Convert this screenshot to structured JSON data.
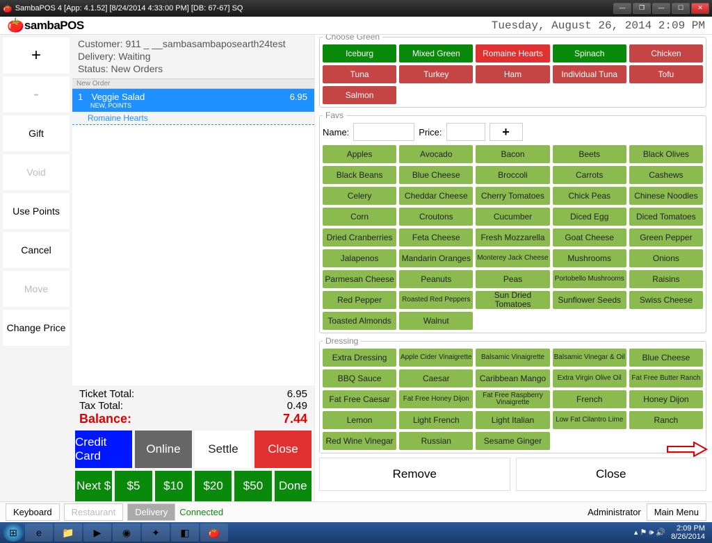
{
  "window": {
    "title": "SambaPOS 4 [App: 4.1.52] [8/24/2014 4:33:00 PM] [DB: 67-67] SQ"
  },
  "header": {
    "logo_a": "samba",
    "logo_b": "POS",
    "datetime": "Tuesday, August 26, 2014 2:09 PM"
  },
  "actions": {
    "add": "+",
    "minus": "-",
    "gift": "Gift",
    "void": "Void",
    "usepoints": "Use Points",
    "cancel": "Cancel",
    "move": "Move",
    "changeprice": "Change Price"
  },
  "customer": {
    "line1": "Customer: 911 _ __sambasambaposearth24test",
    "line2": "Delivery: Waiting",
    "line3": "Status: New Orders"
  },
  "order": {
    "header": "New Order",
    "qty": "1",
    "name": "Veggie Salad",
    "price": "6.95",
    "tags": "NEW, POINTS",
    "modifier": "Romaine Hearts"
  },
  "totals": {
    "ticket_label": "Ticket Total:",
    "ticket_val": "6.95",
    "tax_label": "Tax Total:",
    "tax_val": "0.49",
    "balance_label": "Balance:",
    "balance_val": "7.44"
  },
  "pay": {
    "cc": "Credit Card",
    "online": "Online",
    "settle": "Settle",
    "close": "Close"
  },
  "cash": {
    "next": "Next $",
    "b5": "$5",
    "b10": "$10",
    "b20": "$20",
    "b50": "$50",
    "done": "Done"
  },
  "groups": {
    "choose_green": "Choose Green",
    "greens": [
      "Iceburg",
      "Mixed Green",
      "Romaine Hearts",
      "Spinach",
      "Chicken",
      "Tuna",
      "Turkey",
      "Ham",
      "Individual Tuna",
      "Tofu",
      "Salmon"
    ],
    "greens_color": [
      "green",
      "green",
      "sel",
      "green",
      "red",
      "red",
      "red",
      "red",
      "red",
      "red",
      "red"
    ],
    "favs_legend": "Favs",
    "name_label": "Name:",
    "price_label": "Price:",
    "plus": "+",
    "favs": [
      "Apples",
      "Avocado",
      "Bacon",
      "Beets",
      "Black Olives",
      "Black Beans",
      "Blue Cheese",
      "Broccoli",
      "Carrots",
      "Cashews",
      "Celery",
      "Cheddar Cheese",
      "Cherry Tomatoes",
      "Chick Peas",
      "Chinese Noodles",
      "Corn",
      "Croutons",
      "Cucumber",
      "Diced Egg",
      "Diced Tomatoes",
      "Dried Cranberries",
      "Feta Cheese",
      "Fresh Mozzarella",
      "Goat Cheese",
      "Green Pepper",
      "Jalapenos",
      "Mandarin Oranges",
      "Monterey Jack Cheese",
      "Mushrooms",
      "Onions",
      "Parmesan Cheese",
      "Peanuts",
      "Peas",
      "Portobello Mushrooms",
      "Raisins",
      "Red Pepper",
      "Roasted Red Peppers",
      "Sun Dried Tomatoes",
      "Sunflower Seeds",
      "Swiss Cheese",
      "Toasted Almonds",
      "Walnut"
    ],
    "dressing_legend": "Dressing",
    "dressings": [
      "Extra Dressing",
      "Apple Cider Vinaigrette",
      "Balsamic Vinaigrette",
      "Balsamic Vinegar & Oil",
      "Blue Cheese",
      "BBQ Sauce",
      "Caesar",
      "Caribbean Mango",
      "Extra Virgin Olive Oil",
      "Fat Free Butter Ranch",
      "Fat Free Caesar",
      "Fat Free Honey Dijon",
      "Fat Free Raspberry Vinaigrette",
      "French",
      "Honey Dijon",
      "Lemon",
      "Light French",
      "Light Italian",
      "Low Fat Cilantro Lime",
      "Ranch",
      "Red Wine Vinegar",
      "Russian",
      "Sesame Ginger"
    ]
  },
  "panel_actions": {
    "remove": "Remove",
    "close": "Close"
  },
  "status": {
    "keyboard": "Keyboard",
    "restaurant": "Restaurant",
    "delivery": "Delivery",
    "connected": "Connected",
    "admin": "Administrator",
    "mainmenu": "Main Menu"
  },
  "tray": {
    "time": "2:09 PM",
    "date": "8/26/2014"
  }
}
